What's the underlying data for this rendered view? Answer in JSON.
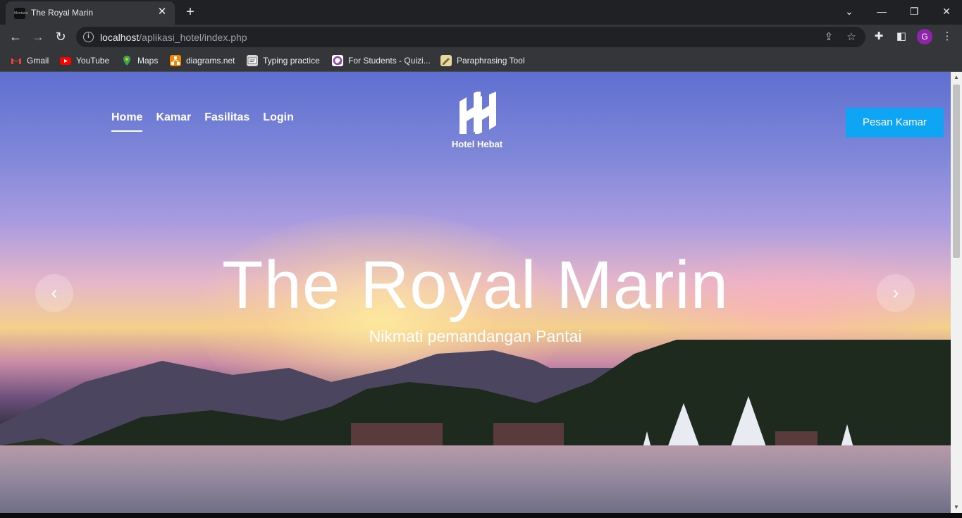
{
  "browser": {
    "tab_title": "The Royal Marin",
    "tab_favicon_text": "Mentaria",
    "url_host": "localhost",
    "url_path": "/aplikasi_hotel/index.php",
    "profile_initial": "G",
    "bookmarks": [
      {
        "label": "Gmail",
        "icon": "gmail-icon",
        "color": "#ea4335"
      },
      {
        "label": "YouTube",
        "icon": "youtube-icon",
        "color": "#ff0000"
      },
      {
        "label": "Maps",
        "icon": "maps-icon",
        "color": "#34a853"
      },
      {
        "label": "diagrams.net",
        "icon": "diagrams-icon",
        "color": "#f08705"
      },
      {
        "label": "Typing practice",
        "icon": "typing-icon",
        "color": "#dddddd"
      },
      {
        "label": "For Students - Quizi...",
        "icon": "quizizz-icon",
        "color": "#8e44ad"
      },
      {
        "label": "Paraphrasing Tool",
        "icon": "paraphrase-icon",
        "color": "#e8d9a0"
      }
    ]
  },
  "site": {
    "nav": [
      "Home",
      "Kamar",
      "Fasilitas",
      "Login"
    ],
    "active_nav": "Home",
    "logo_text": "Hotel Hebat",
    "cta_label": "Pesan Kamar",
    "cta_color": "#0ea5f5"
  },
  "hero": {
    "title": "The Royal Marin",
    "subtitle": "Nikmati pemandangan Pantai",
    "prev_label": "‹",
    "next_label": "›"
  }
}
